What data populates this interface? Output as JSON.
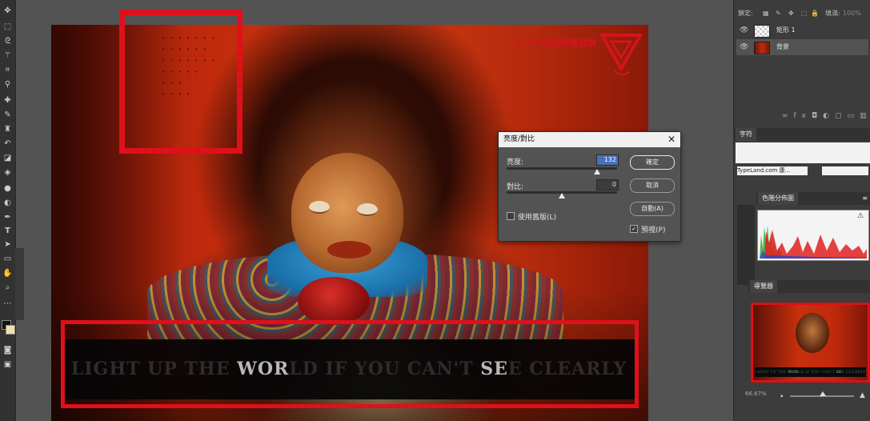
{
  "toolbar": {
    "tools": [
      "move-tool",
      "marquee-tool",
      "lasso-tool",
      "magic-wand-tool",
      "crop-tool",
      "eyedropper-tool",
      "healing-brush-tool",
      "brush-tool",
      "clone-stamp-tool",
      "history-brush-tool",
      "eraser-tool",
      "paint-bucket-tool",
      "blur-tool",
      "dodge-tool",
      "pen-tool",
      "type-tool",
      "path-selection-tool",
      "rectangle-tool",
      "hand-tool",
      "zoom-tool"
    ],
    "type_tool_glyph": "T"
  },
  "canvas": {
    "wall_text": [
      "• • • • • • •",
      "• • • • • •",
      "• • • • • • •",
      "• • • • •",
      "• • •",
      "• • • •"
    ],
    "brand_text": "LOOP迴圈密室逃脫",
    "banner": {
      "part1": "LIGHT UP THE ",
      "hl1": "WOR",
      "part2": "LD IF YOU CAN'T ",
      "hl2": "SE",
      "part3": "E CLEARLY"
    }
  },
  "dialog": {
    "title": "亮度/對比",
    "brightness_label": "亮度:",
    "brightness_value": "132",
    "brightness_level": 0.82,
    "contrast_label": "對比:",
    "contrast_value": "0",
    "contrast_level": 0.5,
    "legacy_label": "使用舊版(L)",
    "legacy_checked": false,
    "ok_label": "確定",
    "cancel_label": "取消",
    "auto_label": "自動(A)",
    "preview_label": "預視(P)",
    "preview_checked": true
  },
  "layers": {
    "lock_label": "鎖定:",
    "fill_label": "填滿:",
    "fill_value": "100%",
    "items": [
      {
        "name": "矩形 1",
        "visible": true
      },
      {
        "name": "背景",
        "visible": true
      }
    ]
  },
  "character_panel": {
    "tab": "字符",
    "font_value": "TypeLand.com 康..."
  },
  "histogram_panel": {
    "tab": "色階分佈圖",
    "warning_icon": "⚠"
  },
  "navigator_panel": {
    "tab": "導覽器",
    "zoom_value": "66.67%"
  },
  "colors": {
    "accent_red": "#e0101a",
    "banner_highlight": "#b8b8b8"
  }
}
